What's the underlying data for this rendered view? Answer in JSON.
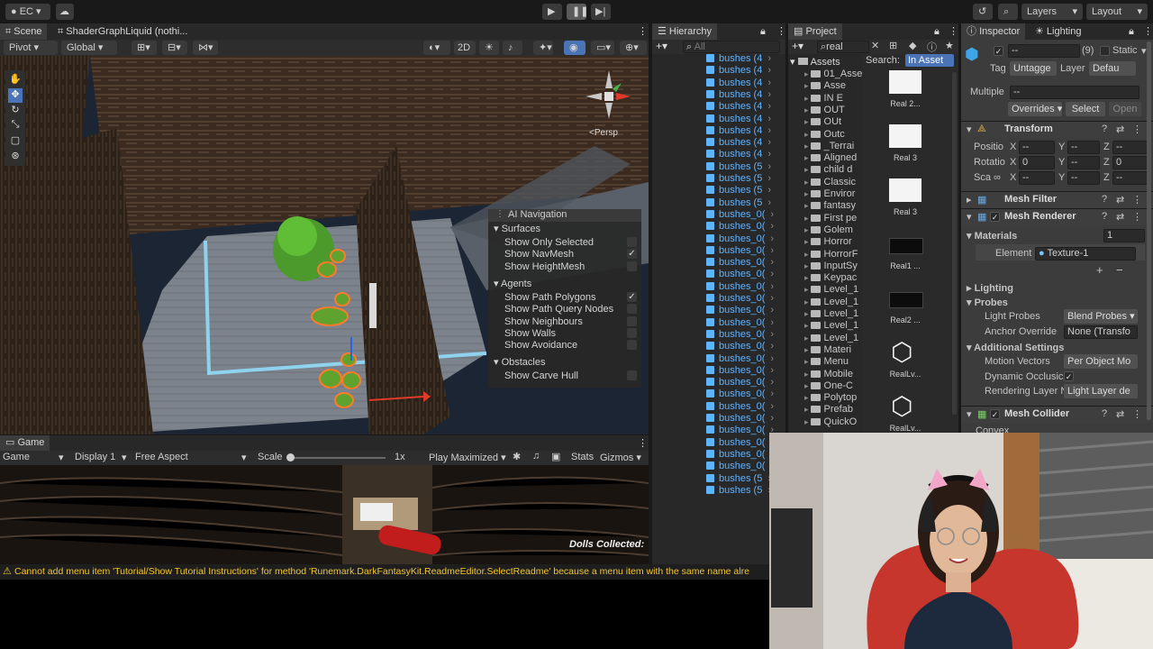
{
  "toolbar": {
    "account": "EC",
    "layers": "Layers",
    "layout": "Layout"
  },
  "scene": {
    "tab_scene": "Scene",
    "tab_shader": "ShaderGraphLiquid (nothi...",
    "pivot": "Pivot",
    "global": "Global",
    "mode_2d": "2D",
    "persp": "<Persp"
  },
  "ai_nav": {
    "title": "AI Navigation",
    "surfaces": "Surfaces",
    "items_surfaces": [
      {
        "label": "Show Only Selected",
        "checked": false
      },
      {
        "label": "Show NavMesh",
        "checked": true
      },
      {
        "label": "Show HeightMesh",
        "checked": false
      }
    ],
    "agents": "Agents",
    "items_agents": [
      {
        "label": "Show Path Polygons",
        "checked": true
      },
      {
        "label": "Show Path Query Nodes",
        "checked": false
      },
      {
        "label": "Show Neighbours",
        "checked": false
      },
      {
        "label": "Show Walls",
        "checked": false
      },
      {
        "label": "Show Avoidance",
        "checked": false
      }
    ],
    "obstacles": "Obstacles",
    "items_obstacles": [
      {
        "label": "Show Carve Hull",
        "checked": false
      }
    ]
  },
  "game": {
    "tab": "Game",
    "display_mode": "Game",
    "display": "Display 1",
    "aspect": "Free Aspect",
    "scale_label": "Scale",
    "scale_value": "1x",
    "play_maximized": "Play Maximized",
    "stats": "Stats",
    "gizmos": "Gizmos",
    "hud_text": "Dolls Collected:"
  },
  "hierarchy": {
    "title": "Hierarchy",
    "search_placeholder": "All",
    "rows": [
      "bushes (4",
      "bushes (4",
      "bushes (4",
      "bushes (4",
      "bushes (4",
      "bushes (4",
      "bushes (4",
      "bushes (4",
      "bushes (4",
      "bushes (5",
      "bushes (5",
      "bushes (5",
      "bushes (5",
      "bushes_0(",
      "bushes_0(",
      "bushes_0(",
      "bushes_0(",
      "bushes_0(",
      "bushes_0(",
      "bushes_0(",
      "bushes_0(",
      "bushes_0(",
      "bushes_0(",
      "bushes_0(",
      "bushes_0(",
      "bushes_0(",
      "bushes_0(",
      "bushes_0(",
      "bushes_0(",
      "bushes_0(",
      "bushes_0(",
      "bushes_0(",
      "bushes_0(",
      "bushes_0(",
      "bushes_0(",
      "bushes (5",
      "bushes (5"
    ]
  },
  "project": {
    "title": "Project",
    "search_value": "real",
    "assets_root": "Assets",
    "search_label": "Search:",
    "search_scope": "In Asset",
    "folders": [
      "01_Asse",
      "Asse",
      "IN E",
      "OUT",
      "OUt",
      "Outc",
      "_Terrai",
      "Aligned",
      "child d",
      "Classic",
      "Enviror",
      "fantasy",
      "First pe",
      "Golem",
      "Horror",
      "HorrorF",
      "InputSy",
      "Keypac",
      "Level_1",
      "Level_1",
      "Level_1",
      "Level_1",
      "Level_1",
      "Materi",
      "Menu",
      "Mobile",
      "One-C",
      "Polytop",
      "Prefab",
      "QuickO"
    ],
    "results": [
      {
        "label": "Real 2...",
        "kind": "white"
      },
      {
        "label": "Real 3",
        "kind": "white"
      },
      {
        "label": "Real 3",
        "kind": "white"
      },
      {
        "label": "Real1 ...",
        "kind": "dark"
      },
      {
        "label": "Real2 ...",
        "kind": "dark"
      },
      {
        "label": "RealLv...",
        "kind": "unity"
      },
      {
        "label": "RealLv...",
        "kind": "unity"
      }
    ]
  },
  "inspector": {
    "tab_inspector": "Inspector",
    "tab_lighting": "Lighting",
    "object_name": "--",
    "count": "(9)",
    "static": "Static",
    "tag_label": "Tag",
    "tag_value": "Untagge",
    "layer_label": "Layer",
    "layer_value": "Defau",
    "multiple_label": "Multiple",
    "multiple_value": "--",
    "overrides": "Overrides",
    "select": "Select",
    "open": "Open",
    "transform": "Transform",
    "position": "Positio",
    "rotation": "Rotatio",
    "scale": "Sca",
    "pos": {
      "x": "--",
      "y": "--",
      "z": "--"
    },
    "rot": {
      "x": "0",
      "y": "--",
      "z": "0"
    },
    "scl": {
      "x": "--",
      "y": "--",
      "z": "--"
    },
    "mesh_filter": "Mesh Filter",
    "mesh_renderer": "Mesh Renderer",
    "materials": "Materials",
    "materials_count": "1",
    "element_label": "Element",
    "element_value": "Texture-1",
    "lighting": "Lighting",
    "probes": "Probes",
    "light_probes": "Light Probes",
    "light_probes_value": "Blend Probes",
    "anchor_override": "Anchor Override",
    "anchor_value": "None (Transfo",
    "additional_settings": "Additional Settings",
    "motion_vectors": "Motion Vectors",
    "motion_value": "Per Object Mo",
    "dynamic_occlusion": "Dynamic Occlusic",
    "rendering_layer": "Rendering Layer N",
    "rendering_value": "Light Layer de",
    "mesh_collider": "Mesh Collider",
    "convex": "Convex"
  },
  "console": {
    "message": "Cannot add menu item 'Tutorial/Show Tutorial Instructions' for method 'Runemark.DarkFantasyKit.ReadmeEditor.SelectReadme' because a menu item with the same name alre"
  }
}
